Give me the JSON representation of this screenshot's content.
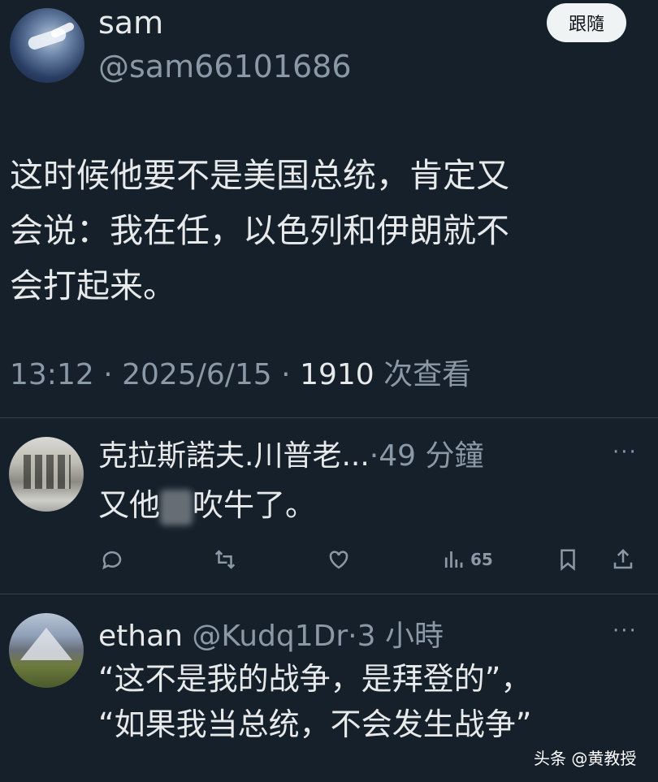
{
  "post": {
    "author_name": "sam",
    "author_handle": "@sam66101686",
    "follow_label": "跟隨",
    "text_line1": "这时候他要不是美国总统，肯定又",
    "text_line2": "会说：我在任，以色列和伊朗就不",
    "text_line3": "会打起来。",
    "time": "13:12",
    "sep1": "·",
    "date": "2025/6/15",
    "sep2": "·",
    "views_count": "1910",
    "views_label": " 次查看"
  },
  "replies": [
    {
      "name": "克拉斯諾夫.川普老...",
      "meta": "·49 分鐘",
      "text_part1": "又他",
      "text_part2": "吹牛了。",
      "more": "···",
      "views_count": "65",
      "icons": [
        "reply-icon",
        "retweet-icon",
        "like-icon",
        "views-icon",
        "bookmark-icon",
        "share-icon"
      ]
    },
    {
      "name": "ethan",
      "meta": " @Kudq1Dr·3 小時",
      "text_line1": "“这不是我的战争，是拜登的”，",
      "text_line2": "“如果我当总统，不会发生战争”",
      "more": "···"
    }
  ],
  "watermark": "头条 @黄教授",
  "colors": {
    "background": "#15202b",
    "text": "#e7e9ea",
    "muted": "#8b98a5",
    "divider": "#38444d"
  }
}
